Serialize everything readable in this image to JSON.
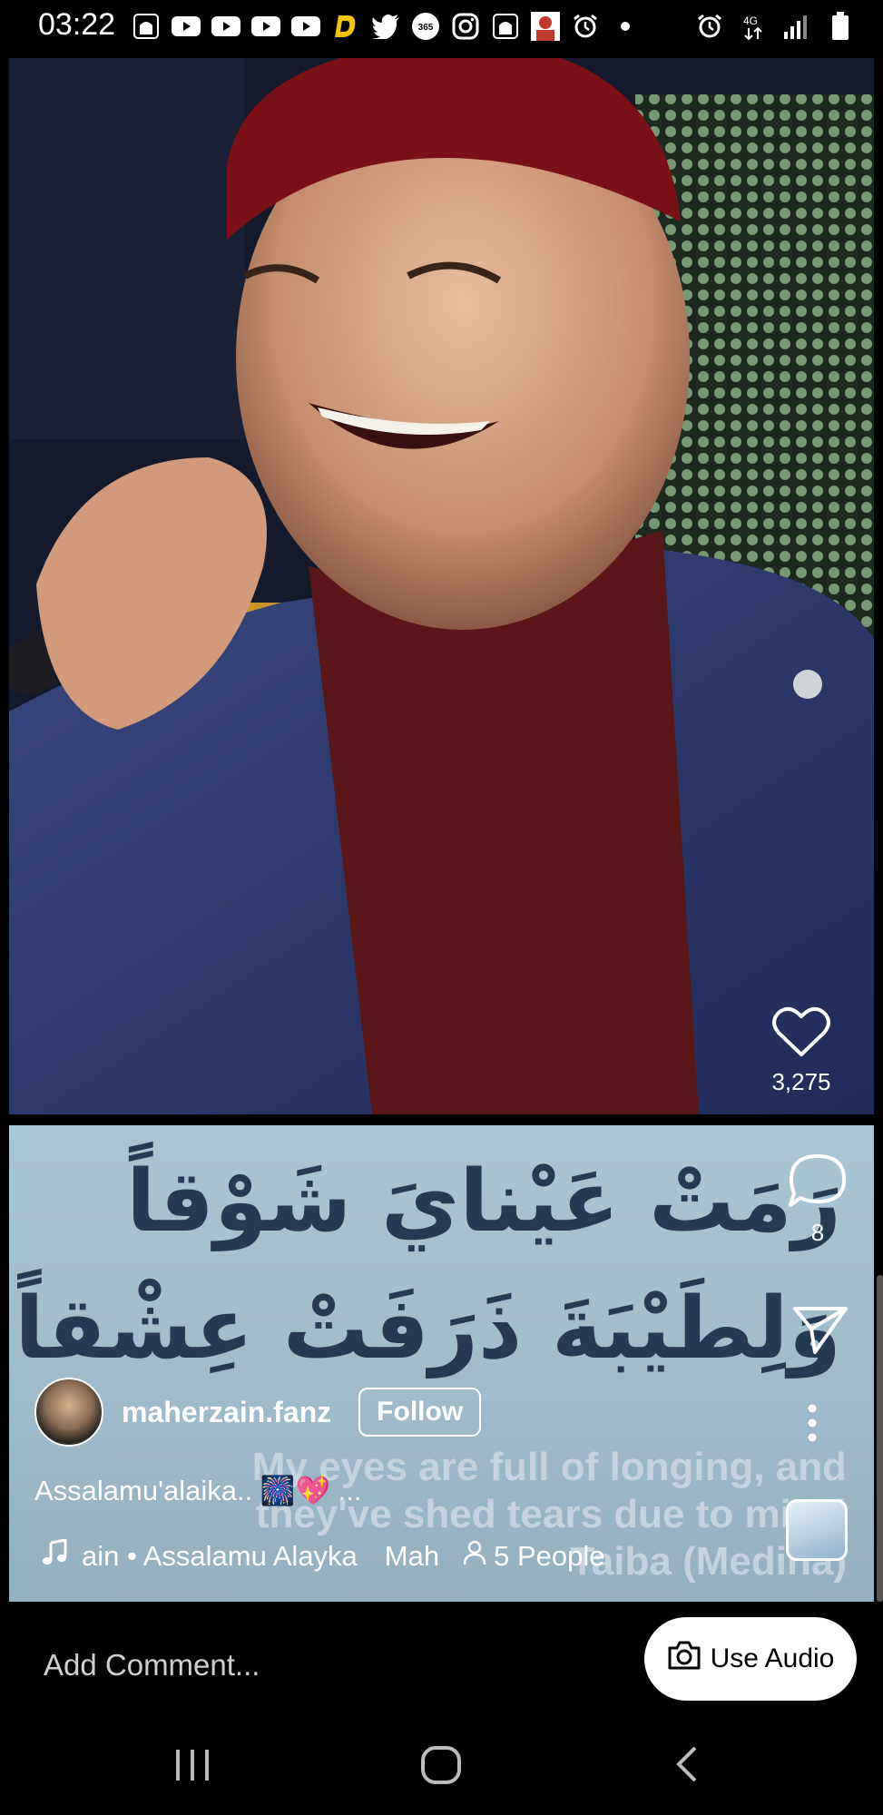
{
  "status_bar": {
    "time": "03:22",
    "left_icons": [
      "mosque-icon",
      "youtube-icon",
      "youtube-icon",
      "youtube-icon",
      "youtube-icon",
      "dlive-icon",
      "twitter-icon",
      "365-icon",
      "instagram-icon",
      "mosque-icon",
      "photo-icon",
      "alarm-icon",
      "dot-icon"
    ],
    "right_icons": [
      "alarm-icon",
      "data-icon",
      "signal-icon",
      "battery-icon"
    ]
  },
  "post": {
    "likes": "3,275",
    "comments": "8",
    "username": "maherzain.fanz",
    "follow_label": "Follow",
    "caption": "Assalamu'alaika.. 🎆💖 ...",
    "audio": {
      "track": "ain • Assalamu Alayka",
      "artist": "Mah",
      "people": "5 People"
    }
  },
  "lyrics": {
    "arabic_line1": "رَمَتْ عَيْنايَ شَوْقاً",
    "arabic_line2": "وَلِطَيْبَةَ ذَرَفَتْ عِشْقاً",
    "english_line1": "My eyes are full of longing, and",
    "english_line2": "they've shed tears due to missi",
    "english_line3": "Taiba (Medina)"
  },
  "comment_bar": {
    "placeholder": "Add Comment...",
    "use_audio_label": "Use Audio"
  },
  "colors": {
    "background": "#000000",
    "lyrics_text": "#243a55",
    "panel": "#a9c6d3"
  }
}
